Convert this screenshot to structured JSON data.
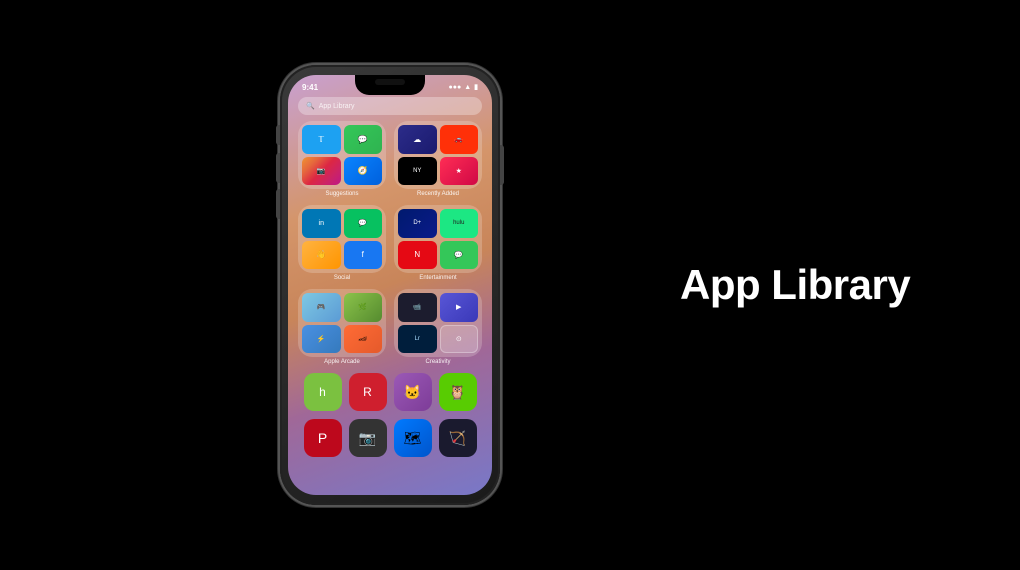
{
  "page": {
    "background": "#000000",
    "title": "App Library"
  },
  "status_bar": {
    "time": "9:41",
    "signal": "●●●",
    "wifi": "wifi",
    "battery": "battery"
  },
  "search_bar": {
    "placeholder": "App Library"
  },
  "app_library_title": "App Library",
  "folders": [
    {
      "name": "suggestions-folder",
      "label": "Suggestions",
      "apps": [
        "Twitter",
        "Messages",
        "Instagram",
        "Safari"
      ]
    },
    {
      "name": "recently-added-folder",
      "label": "Recently Added",
      "apps": [
        "CloudApp",
        "DoorDash",
        "NYTimes",
        "Misc"
      ]
    },
    {
      "name": "social-folder",
      "label": "Social",
      "apps": [
        "LinkedIn",
        "WeChat",
        "Hand Wave",
        "Facebook"
      ]
    },
    {
      "name": "entertainment-folder",
      "label": "Entertainment",
      "apps": [
        "Disney+",
        "Hulu",
        "Netflix",
        "Messages"
      ]
    },
    {
      "name": "apple-arcade-folder",
      "label": "Apple Arcade",
      "apps": [
        "Game1",
        "Game2",
        "Game3",
        "Game4"
      ]
    },
    {
      "name": "creativity-folder",
      "label": "Creativity",
      "apps": [
        "Camera",
        "Action",
        "Lightroom",
        "Circle"
      ]
    }
  ],
  "standalone_rows": [
    [
      "Houzz",
      "Redfin",
      "Game5",
      "Duolingo"
    ],
    [
      "Pinterest",
      "Misc",
      "Blue",
      "Arrow"
    ]
  ]
}
